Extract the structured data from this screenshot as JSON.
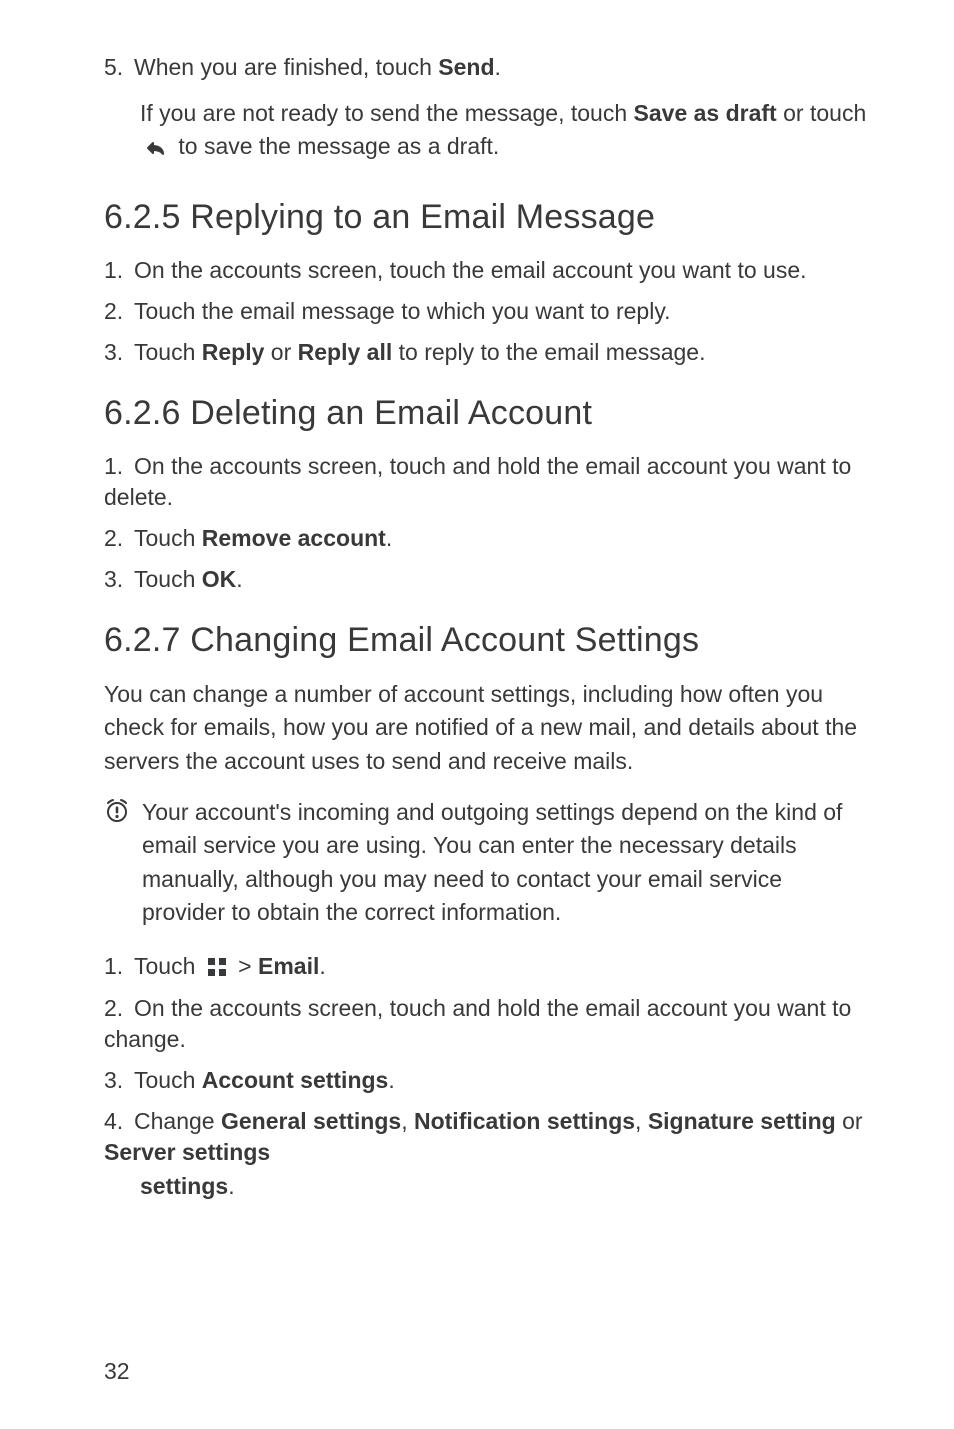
{
  "step5": {
    "num": "5.",
    "text_before": "When you are finished, touch ",
    "send": "Send",
    "period": "."
  },
  "step5_note": {
    "pre": "If you are not ready to send the message, touch ",
    "save_as_draft": "Save as draft",
    "mid": " or touch ",
    "post": " to save the message as a draft."
  },
  "section625": "6.2.5  Replying to an Email Message",
  "s625": {
    "i1n": "1.",
    "i1t": "On the accounts screen, touch the email account you want to use.",
    "i2n": "2.",
    "i2t": "Touch the email message to which you want to reply.",
    "i3n": "3.",
    "i3t_pre": "Touch ",
    "reply": "Reply",
    "i3t_mid": " or ",
    "reply_all": "Reply all",
    "i3t_post": " to reply to the email message."
  },
  "section626": "6.2.6  Deleting an Email Account",
  "s626": {
    "i1n": "1.",
    "i1t": "On the accounts screen, touch and hold the email account you want to delete.",
    "i2n": "2.",
    "i2t_pre": "Touch ",
    "remove_account": "Remove account",
    "period": ".",
    "i3n": "3.",
    "i3t_pre": "Touch ",
    "ok": "OK"
  },
  "section627": "6.2.7  Changing Email Account Settings",
  "s627_para": "You can change a number of account settings, including how often you check for emails, how you are notified of a new mail, and details about the servers the account uses to send and receive mails.",
  "s627_callout": "Your account's incoming and outgoing settings depend on the kind of email service you are using. You can enter the necessary details manually, although you may need to contact your email service provider to obtain the correct information.",
  "s627": {
    "i1n": "1.",
    "i1_pre": "Touch ",
    "i1_mid": " > ",
    "email": "Email",
    "period": ".",
    "i2n": "2.",
    "i2t": "On the accounts screen, touch and hold the email account you want to change.",
    "i3n": "3.",
    "i3_pre": "Touch ",
    "account_settings": "Account settings",
    "i4n": "4.",
    "i4_pre": "Change ",
    "general_settings": "General settings",
    "c1": ", ",
    "notification_settings": "Notification settings",
    "c2": ", ",
    "signature_setting": "Signature setting",
    "or": " or ",
    "server_settings": "Server settings"
  },
  "page_number": "32"
}
